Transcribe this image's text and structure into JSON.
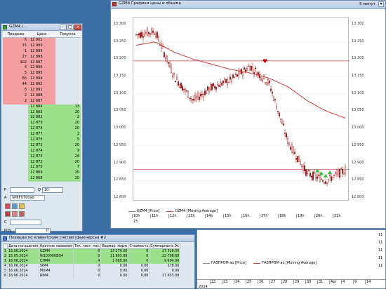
{
  "orderbook": {
    "title": "GZM4 (...",
    "headers": [
      "Продажа",
      "Цена",
      "Покупка"
    ],
    "rows": [
      {
        "side": "sell",
        "sell": "6",
        "price": "12 901",
        "buy": ""
      },
      {
        "side": "sell",
        "sell": "15",
        "price": "12 900",
        "buy": ""
      },
      {
        "side": "sell",
        "sell": "1",
        "price": "12 899",
        "buy": ""
      },
      {
        "side": "sell",
        "sell": "27",
        "price": "12 898",
        "buy": ""
      },
      {
        "side": "sell",
        "sell": "102",
        "price": "12 897",
        "buy": ""
      },
      {
        "side": "sell",
        "sell": "4",
        "price": "12 896",
        "buy": ""
      },
      {
        "side": "sell",
        "sell": "5",
        "price": "12 895",
        "buy": ""
      },
      {
        "side": "sell",
        "sell": "66",
        "price": "12 894",
        "buy": ""
      },
      {
        "side": "sell",
        "sell": "44",
        "price": "12 892",
        "buy": ""
      },
      {
        "side": "sell",
        "sell": "6",
        "price": "12 891",
        "buy": ""
      },
      {
        "side": "sell",
        "sell": "2",
        "price": "12 888",
        "buy": ""
      },
      {
        "side": "sell",
        "sell": "2",
        "price": "12 887",
        "buy": ""
      },
      {
        "side": "buy",
        "sell": "",
        "price": "12 884",
        "buy": "13"
      },
      {
        "side": "buy",
        "sell": "",
        "price": "12 883",
        "buy": "20"
      },
      {
        "side": "buy",
        "sell": "",
        "price": "12 882",
        "buy": "2"
      },
      {
        "side": "buy",
        "sell": "",
        "price": "12 879",
        "buy": "20"
      },
      {
        "side": "buy",
        "sell": "",
        "price": "12 878",
        "buy": "20"
      },
      {
        "side": "buy",
        "sell": "",
        "price": "12 877",
        "buy": "2"
      },
      {
        "side": "buy",
        "sell": "",
        "price": "12 876",
        "buy": "5"
      },
      {
        "side": "buy",
        "sell": "",
        "price": "12 875",
        "buy": "20"
      },
      {
        "side": "buy",
        "sell": "",
        "price": "12 874",
        "buy": "9"
      },
      {
        "side": "buy",
        "sell": "",
        "price": "12 873",
        "buy": "24"
      },
      {
        "side": "buy",
        "sell": "",
        "price": "12 872",
        "buy": "20"
      },
      {
        "side": "buy",
        "sell": "",
        "price": "12 870",
        "buy": "7"
      },
      {
        "side": "buy",
        "sell": "",
        "price": "12 869",
        "buy": "20"
      },
      {
        "side": "buy",
        "sell": "",
        "price": "12 868",
        "buy": "20"
      }
    ],
    "p_label": "P",
    "q_label": "Q",
    "q_value": "10",
    "a_label": "A",
    "account": "SPBFUT00ad",
    "c_label": "C",
    "pos_label": "POS",
    "pos_value": "0",
    "b_label": "B"
  },
  "chart": {
    "title": "GZM4 Графики цены и объема",
    "timeframe": "5 минут",
    "y_ticks": [
      "13 300",
      "13 250",
      "13 200",
      "13 150",
      "13 100",
      "13 050",
      "13 000",
      "12 950",
      "12 900",
      "12 850",
      "12 800"
    ],
    "x_ticks": [
      "10h",
      "11h",
      "12h",
      "13h",
      "14h",
      "15h",
      "16h",
      "17h",
      "18h",
      "19h",
      "20h",
      "21h"
    ],
    "x_sub": "15",
    "legend_price": "GZM4 [Price]",
    "legend_ma": "GZM4 [Moving Average]",
    "colors": {
      "candle": "#a01818",
      "ma": "#d33a3a",
      "hline": "#d06060"
    }
  },
  "chart_data": {
    "type": "line",
    "title": "GZM4 Графики цены и объема",
    "x": [
      "10h",
      "11h",
      "12h",
      "13h",
      "14h",
      "15h",
      "16h",
      "17h",
      "18h",
      "19h",
      "20h",
      "21h"
    ],
    "ylim": [
      12790,
      13320
    ],
    "series": [
      {
        "name": "GZM4 [Price]",
        "values": [
          13270,
          13280,
          13150,
          13080,
          13120,
          13140,
          13180,
          13130,
          12960,
          12870,
          12850,
          12880
        ]
      },
      {
        "name": "GZM4 [Moving Average]",
        "values": [
          13240,
          13250,
          13220,
          13200,
          13185,
          13170,
          13160,
          13145,
          13120,
          13080,
          13050,
          13030
        ]
      }
    ],
    "hline": [
      13195,
      12882
    ]
  },
  "chart2": {
    "legend_price": "ГАЗПРОМ ао [Price]",
    "legend_ma": "ГАЗПРОМ ао [Moving Average]",
    "y_ticks": [
      "11",
      "11",
      "11",
      "11",
      "11"
    ],
    "x_ticks": [
      "22",
      "23",
      "24",
      "25",
      "26",
      "27",
      "28",
      "29",
      "30",
      "31",
      "Apr",
      "4",
      "9",
      "14"
    ],
    "x_year": "2014"
  },
  "positions": {
    "title": "Позиции по клиентским счетам (фьючерсы) #2",
    "headers": [
      "",
      "Дата погашения",
      "Краткое названия",
      "Тек. чист. поз.",
      "Вармар. марж",
      "Стоимость",
      "Суммарная в Эк"
    ],
    "rows": [
      {
        "hl": true,
        "n": "1",
        "date": "16.06.2014",
        "name": "GZM4",
        "pos": "0",
        "var": "13 270.00",
        "cost": "0",
        "sum": "27 528.00"
      },
      {
        "hl": true,
        "n": "2",
        "date": "15.05.2014",
        "name": "RI100000BQ4",
        "pos": "0",
        "var": "11 993.09",
        "cost": "0",
        "sum": "22 708.68"
      },
      {
        "hl": true,
        "n": "3",
        "date": "16.06.2014",
        "name": "CHM4",
        "pos": "4",
        "var": "1 080.00",
        "cost": "0",
        "sum": "9 604.00"
      },
      {
        "hl": false,
        "n": "4",
        "date": "16.06.2014",
        "name": "SiM4",
        "pos": "0",
        "var": "0.00",
        "cost": "0.00",
        "sum": "178.00"
      },
      {
        "hl": false,
        "n": "5",
        "date": "16.06.2014",
        "name": "MXM4",
        "pos": "0",
        "var": "0.00",
        "cost": "0.00",
        "sum": "0.00"
      },
      {
        "hl": false,
        "n": "6",
        "date": "16.06.2014",
        "name": "RIM4",
        "pos": "0",
        "var": "0.00",
        "cost": "0.00",
        "sum": "17 633.09"
      }
    ]
  }
}
